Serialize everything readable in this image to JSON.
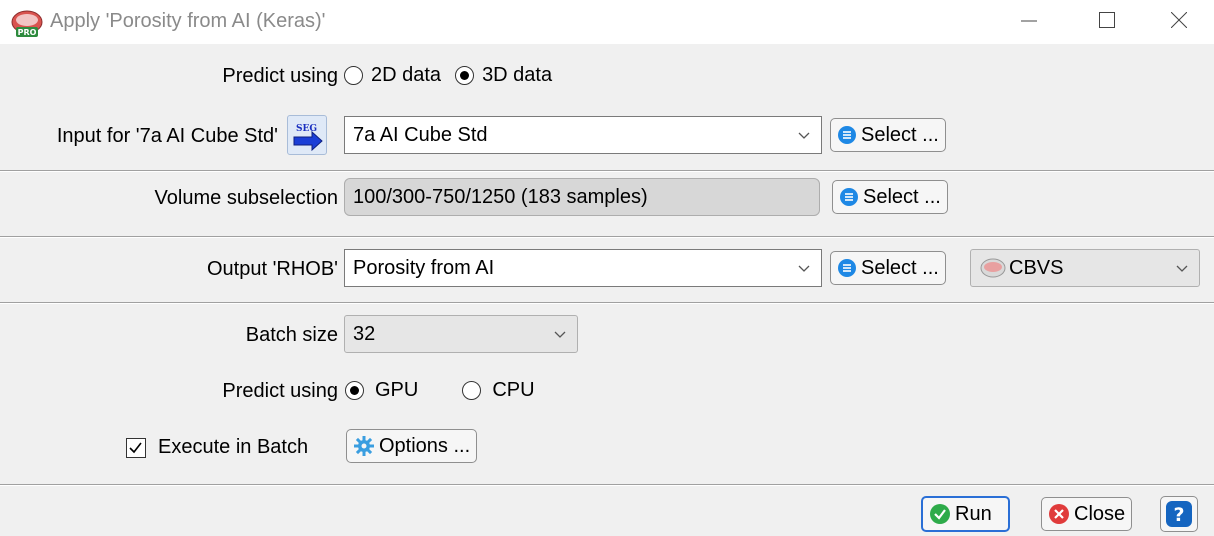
{
  "window": {
    "title": "Apply 'Porosity from AI (Keras)'",
    "icon": "opendtect-pro-icon"
  },
  "predict_data": {
    "label": "Predict using",
    "options": [
      "2D data",
      "3D data"
    ],
    "selected": "3D data"
  },
  "input": {
    "label": "Input for '7a AI Cube Std'",
    "value": "7a AI Cube Std",
    "select_label": "Select ..."
  },
  "volume": {
    "label": "Volume subselection",
    "value": "100/300-750/1250 (183 samples)",
    "select_label": "Select ..."
  },
  "output": {
    "label": "Output 'RHOB'",
    "value": "Porosity from AI",
    "select_label": "Select ...",
    "format_value": "CBVS"
  },
  "batch_size": {
    "label": "Batch size",
    "value": "32"
  },
  "predict_device": {
    "label": "Predict using",
    "options": [
      "GPU",
      "CPU"
    ],
    "selected": "GPU"
  },
  "execute_batch": {
    "label": "Execute in Batch",
    "checked": true,
    "options_label": "Options ..."
  },
  "footer": {
    "run_label": "Run",
    "close_label": "Close",
    "help_symbol": "?"
  },
  "colors": {
    "accent": "#2a6fd6",
    "run_green": "#2eab4a",
    "close_red": "#e03b3b",
    "select_blue": "#1e88e5"
  }
}
